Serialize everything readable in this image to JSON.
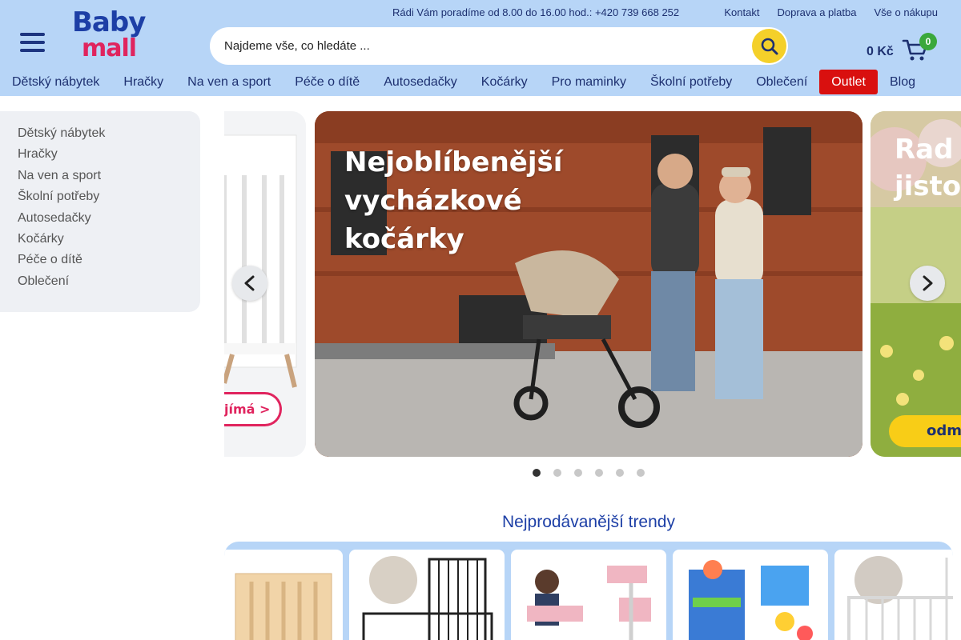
{
  "header": {
    "logo_top": "Baby",
    "logo_bottom": "mall",
    "hotline": "Rádi Vám poradíme od 8.00 do 16.00 hod.: +420 739 668 252",
    "top_links": [
      "Kontakt",
      "Doprava a platba",
      "Vše o nákupu"
    ],
    "search_placeholder": "Najdeme vše, co hledáte ...",
    "cart_price": "0 Kč",
    "cart_count": "0"
  },
  "nav": {
    "items": [
      "Dětský nábytek",
      "Hračky",
      "Na ven a sport",
      "Péče o dítě",
      "Autosedačky",
      "Kočárky",
      "Pro maminky",
      "Školní potřeby",
      "Oblečení",
      "Outlet",
      "Blog"
    ]
  },
  "sidebar": {
    "items": [
      "Dětský nábytek",
      "Hračky",
      "Na ven a sport",
      "Školní potřeby",
      "Autosedačky",
      "Kočárky",
      "Péče o dítě",
      "Oblečení"
    ]
  },
  "carousel": {
    "left_button": "jímá >",
    "main_title": "Nejoblíbenější vycházkové kočárky",
    "right_title_1": "Rad",
    "right_title_2": "jisto",
    "right_button": "odm",
    "dots": 6,
    "active_dot": 0
  },
  "trends": {
    "title": "Nejprodávanější trendy"
  },
  "colors": {
    "header_bg": "#b7d5f7",
    "brand_blue": "#1d3fa6",
    "brand_pink": "#e0245e",
    "outlet_red": "#d9100f",
    "search_yellow": "#f4d02a",
    "cart_green": "#3ba83b"
  },
  "icons": [
    "menu-icon",
    "search-icon",
    "cart-icon",
    "chevron-left-icon",
    "chevron-right-icon"
  ]
}
